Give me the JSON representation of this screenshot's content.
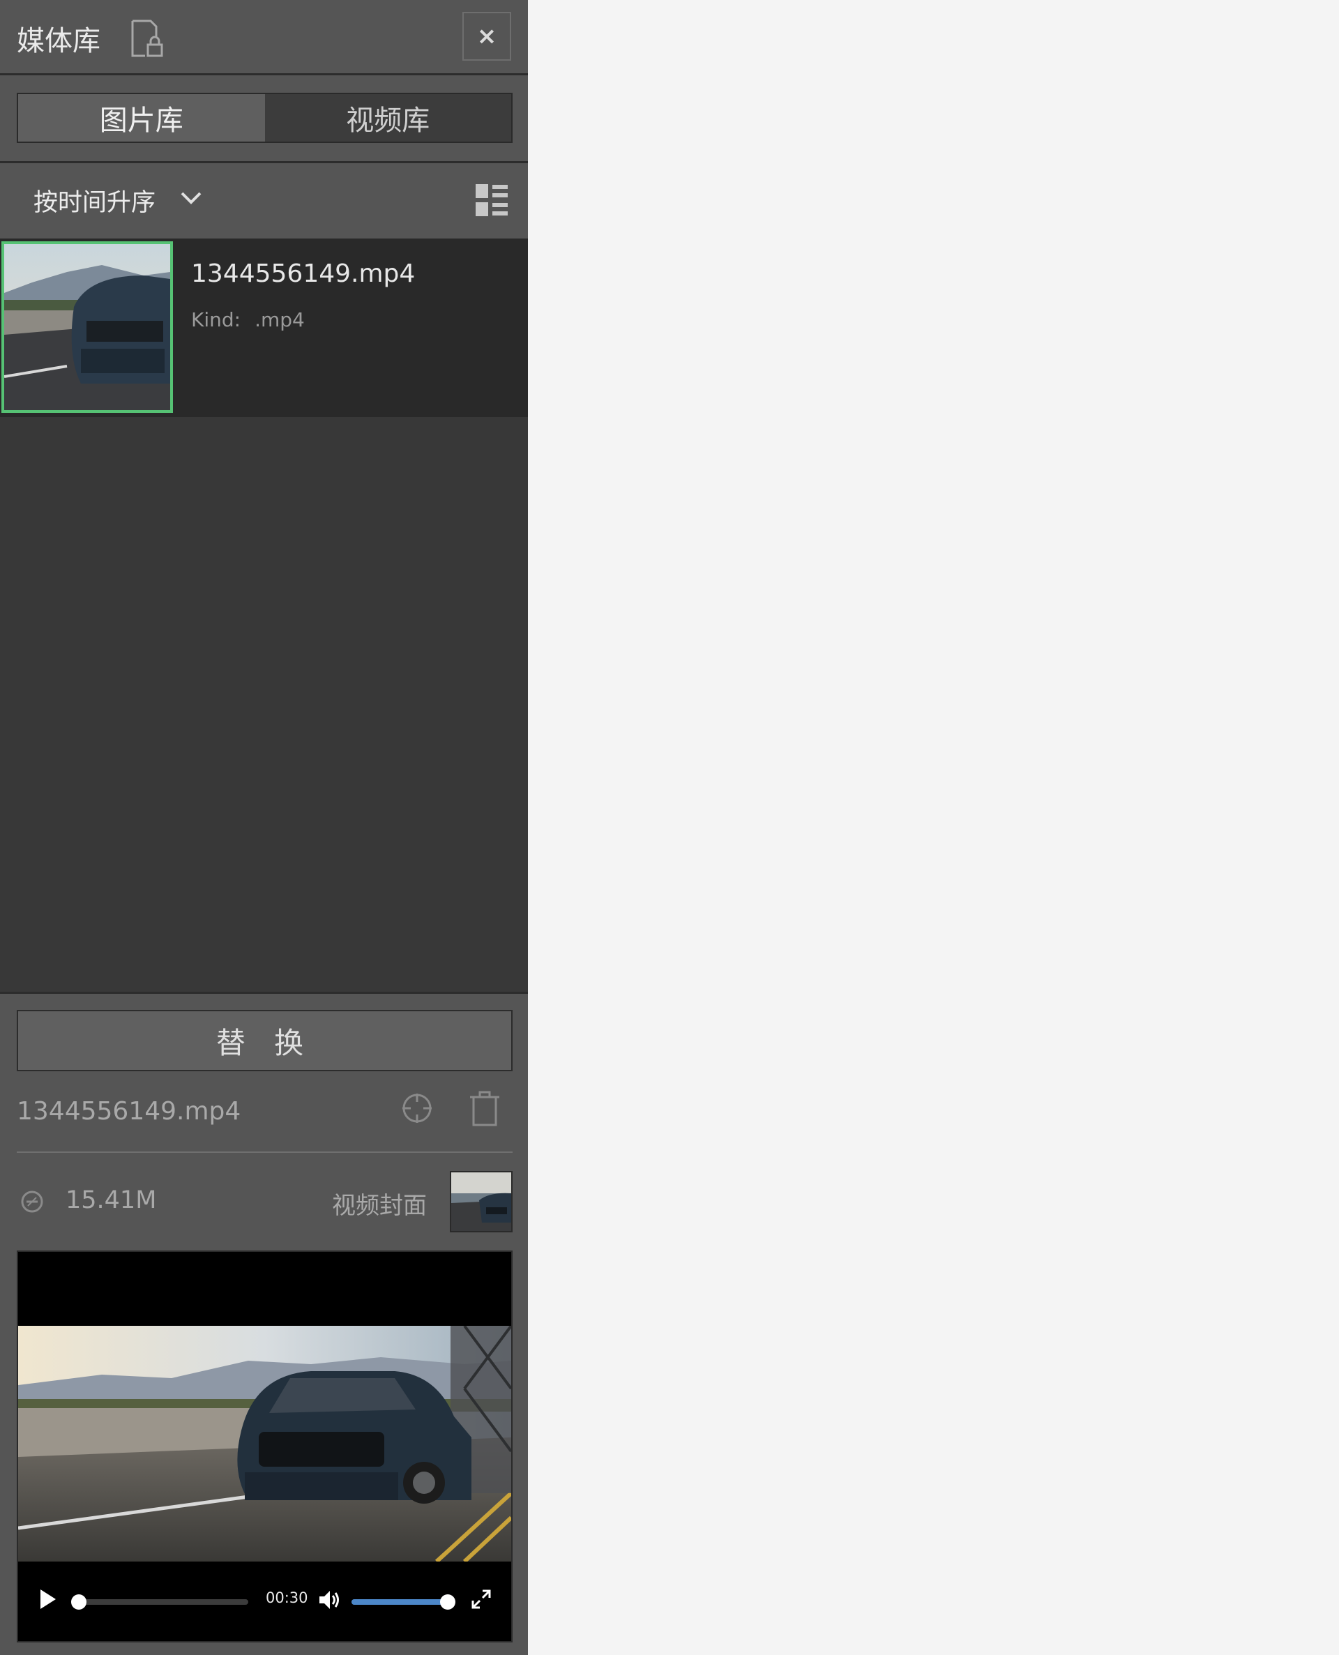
{
  "header": {
    "title": "媒体库"
  },
  "tabs": [
    {
      "label": "图片库",
      "active": true
    },
    {
      "label": "视频库",
      "active": false
    }
  ],
  "sort": {
    "label": "按时间升序"
  },
  "list": {
    "items": [
      {
        "name": "1344556149.mp4",
        "kind_label": "Kind:",
        "kind_value": ".mp4",
        "selected": true
      }
    ]
  },
  "detail": {
    "replace_label": "替 换",
    "name": "1344556149.mp4",
    "size": "15.41M",
    "cover_label": "视频封面"
  },
  "player": {
    "time": "00:30",
    "progress": 0.0,
    "volume": 1.0
  },
  "colors": {
    "accent_selected": "#56c274",
    "volume_fill": "#4c87c9"
  }
}
